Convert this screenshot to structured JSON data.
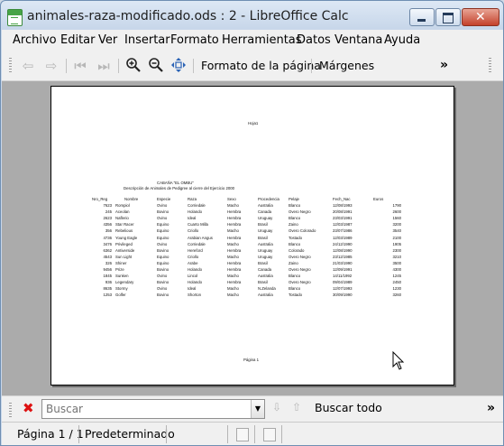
{
  "window": {
    "title": "animales-raza-modificado.ods : 2 - LibreOffice Calc",
    "close_glyph": "✕"
  },
  "menubar": [
    "Archivo",
    "Editar",
    "Ver",
    "Insertar",
    "Formato",
    "Herramientas",
    "Datos",
    "Ventana",
    "Ayuda"
  ],
  "toolbar": {
    "page_format_label": "Formato de la página",
    "margins_label": "Márgenes",
    "more_glyph": "»",
    "icons": [
      "first-page-icon",
      "previous-page-icon",
      "next-page-icon",
      "last-page-icon",
      "zoom-in-icon",
      "zoom-out-icon",
      "full-screen-icon"
    ]
  },
  "preview": {
    "header": "Hoja1",
    "farm_name": "CABAÑA \"EL OMBU\"",
    "subtitle": "Descripción de Animales de Pedigree al cierre del Ejercicio 2000",
    "columns": [
      "Nro_Reg",
      "Nombre",
      "Especie",
      "Raza",
      "Sexo",
      "Procedencia",
      "Pelaje",
      "Fech_Nac",
      "Euros"
    ],
    "rows": [
      [
        "7623",
        "Rompiol",
        "Ovino",
        "Corriedale",
        "Macho",
        "Australia",
        "Blanco",
        "12/08/1993",
        "1790"
      ],
      [
        "245",
        "Aceolan",
        "Bovino",
        "Holando",
        "Hembra",
        "Canada",
        "Overo Negro",
        "20/08/1991",
        "2600"
      ],
      [
        "2623",
        "Naflerio",
        "Ovino",
        "Ideal",
        "Hembra",
        "Uruguay",
        "Blanco",
        "23/03/1991",
        "1560"
      ],
      [
        "4356",
        "Star Racer",
        "Equino",
        "Cuarto Milla",
        "Hembra",
        "Brasil",
        "Zaino",
        "12/03/1987",
        "3200"
      ],
      [
        "356",
        "Rebelious",
        "Equino",
        "Criollo",
        "Macho",
        "Uruguay",
        "Overo Colorado",
        "23/07/1986",
        "3540"
      ],
      [
        "4736",
        "Young Eagle",
        "Equino",
        "Arabian Angus",
        "Hembra",
        "Brasil",
        "Tostado",
        "12/03/1989",
        "2100"
      ],
      [
        "3476",
        "Privileged",
        "Ovino",
        "Corriedale",
        "Macho",
        "Australia",
        "Blanco",
        "24/12/1990",
        "1905"
      ],
      [
        "6362",
        "Antiverside",
        "Bovino",
        "Hereford",
        "Hembra",
        "Uruguay",
        "Colorado",
        "12/08/1990",
        "2300"
      ],
      [
        "4543",
        "Sun Light",
        "Equino",
        "Criollo",
        "Macho",
        "Uruguay",
        "Overo Negro",
        "23/12/1985",
        "3210"
      ],
      [
        "326",
        "Shiner",
        "Equino",
        "Arabe",
        "Hembra",
        "Brasil",
        "Zaino",
        "21/03/1990",
        "3500"
      ],
      [
        "9456",
        "Prize",
        "Bovino",
        "Holando",
        "Hembra",
        "Canada",
        "Overo Negro",
        "12/09/1991",
        "4300"
      ],
      [
        "1845",
        "Sunken",
        "Ovino",
        "Lincol",
        "Macho",
        "Australia",
        "Blanco",
        "14/11/1992",
        "1245"
      ],
      [
        "936",
        "Legendary",
        "Bovino",
        "Holando",
        "Hembra",
        "Brasil",
        "Overo Negro",
        "09/04/1989",
        "2450"
      ],
      [
        "8635",
        "Stormy",
        "Ovino",
        "Ideal",
        "Macho",
        "N.Zelanda",
        "Blanco",
        "12/07/1993",
        "1230"
      ],
      [
        "1253",
        "Golfer",
        "Bovino",
        "Shorton",
        "Macho",
        "Australia",
        "Tostado",
        "30/09/1990",
        "3260"
      ]
    ],
    "footer": "Página 1"
  },
  "findbar": {
    "close_glyph": "✖",
    "search_placeholder": "Buscar",
    "dropdown_glyph": "▼",
    "find_all_label": "Buscar todo",
    "more_glyph": "»",
    "close_color": "#d11111"
  },
  "statusbar": {
    "page": "Página 1 / 1",
    "page_style": "Predeterminado"
  }
}
